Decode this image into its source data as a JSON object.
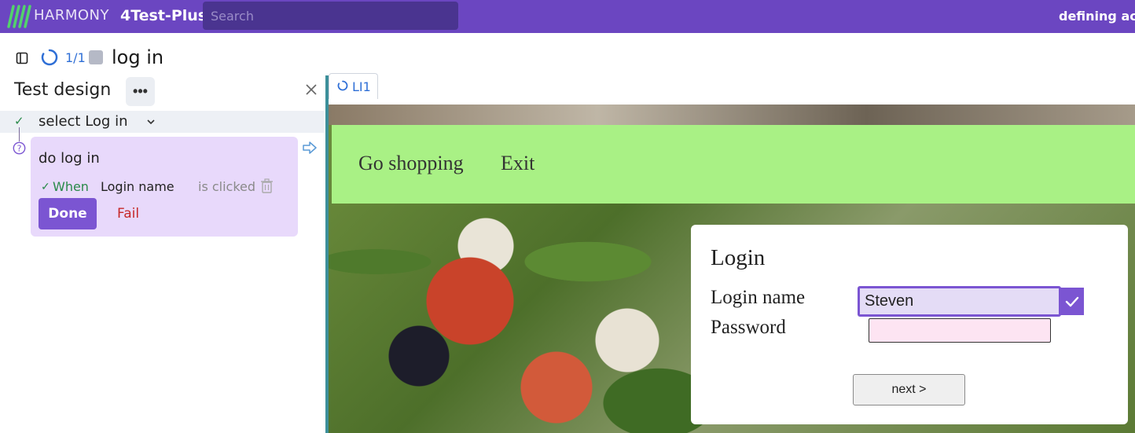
{
  "topbar": {
    "brand": "HARMONY",
    "project": "4Test-Plus",
    "search_placeholder": "Search",
    "status": "defining acti"
  },
  "header": {
    "progress": "1/1",
    "title": "log in"
  },
  "panel": {
    "title": "Test design",
    "more_label": "•••",
    "steps": [
      {
        "label": "select Log in",
        "status": "passed"
      }
    ],
    "card": {
      "title": "do log in",
      "when_label": "When",
      "field": "Login name",
      "action": "is clicked",
      "done_label": "Done",
      "fail_label": "Fail"
    }
  },
  "tabs": [
    {
      "label": "LI1"
    }
  ],
  "preview": {
    "nav": [
      "Go shopping",
      "Exit"
    ],
    "login": {
      "heading": "Login",
      "login_label": "Login name",
      "password_label": "Password",
      "login_value": "Steven",
      "password_value": "",
      "next_label": "next >"
    }
  },
  "colors": {
    "brand": "#6b46c1",
    "accent": "#7b55d2",
    "card": "#e8d9fb",
    "nav_band": "#a9f185",
    "fail": "#c62828",
    "pass": "#2a8a4a"
  }
}
